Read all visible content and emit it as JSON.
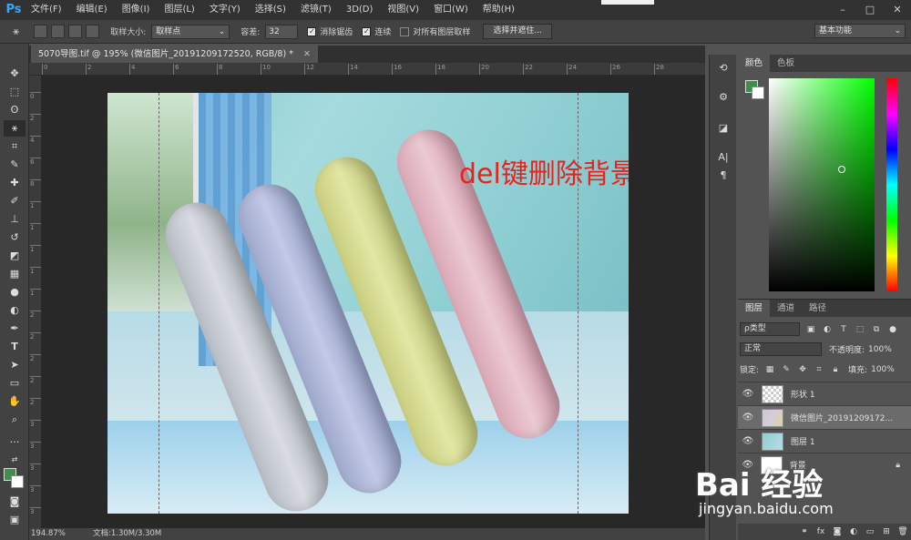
{
  "menubar": {
    "logo": "Ps",
    "items": [
      "文件(F)",
      "编辑(E)",
      "图像(I)",
      "图层(L)",
      "文字(Y)",
      "选择(S)",
      "滤镜(T)",
      "3D(D)",
      "视图(V)",
      "窗口(W)",
      "帮助(H)"
    ],
    "window_controls": [
      "–",
      "□",
      "✕"
    ]
  },
  "options": {
    "sample_size_label": "取样大小:",
    "sample_size_value": "取样点",
    "tolerance_label": "容差:",
    "tolerance_value": "32",
    "anti_alias_label": "消除锯齿",
    "contiguous_label": "连续",
    "all_layers_label": "对所有图层取样",
    "select_mask_button": "选择并遮住...",
    "workspace": "基本功能"
  },
  "document": {
    "tab_title": "5070导图.tif @ 195% (微信图片_20191209172520, RGB/8) *",
    "annotation": "del键删除背景",
    "zoom": "194.87%",
    "doc_size": "文档:1.30M/3.30M"
  },
  "ruler": {
    "h": [
      "0",
      "2",
      "4",
      "6",
      "8",
      "10",
      "12",
      "14",
      "16",
      "18",
      "20",
      "22",
      "24",
      "26",
      "28"
    ],
    "v": [
      "0",
      "2",
      "4",
      "6",
      "8",
      "1",
      "1",
      "1",
      "1",
      "1",
      "2",
      "2",
      "2",
      "2",
      "2",
      "3",
      "3",
      "3",
      "3",
      "3",
      "4"
    ]
  },
  "panels": {
    "color_tabs": [
      "颜色",
      "色板"
    ],
    "layers_tabs": [
      "图层",
      "通道",
      "路径"
    ],
    "filter_kind": "ρ类型",
    "blend_mode": "正常",
    "opacity_label": "不透明度:",
    "opacity_value": "100%",
    "lock_label": "锁定:",
    "fill_label": "填充:",
    "fill_value": "100%",
    "layers": [
      {
        "name": "形状 1"
      },
      {
        "name": "微信图片_20191209172..."
      },
      {
        "name": "图层 1"
      },
      {
        "name": "背景"
      }
    ]
  },
  "watermark": {
    "logo": "Bai 经验",
    "url": "jingyan.baidu.com"
  },
  "colors": {
    "foreground": "#3c8f4c",
    "background": "#ffffff",
    "annotation": "#e8231e"
  }
}
